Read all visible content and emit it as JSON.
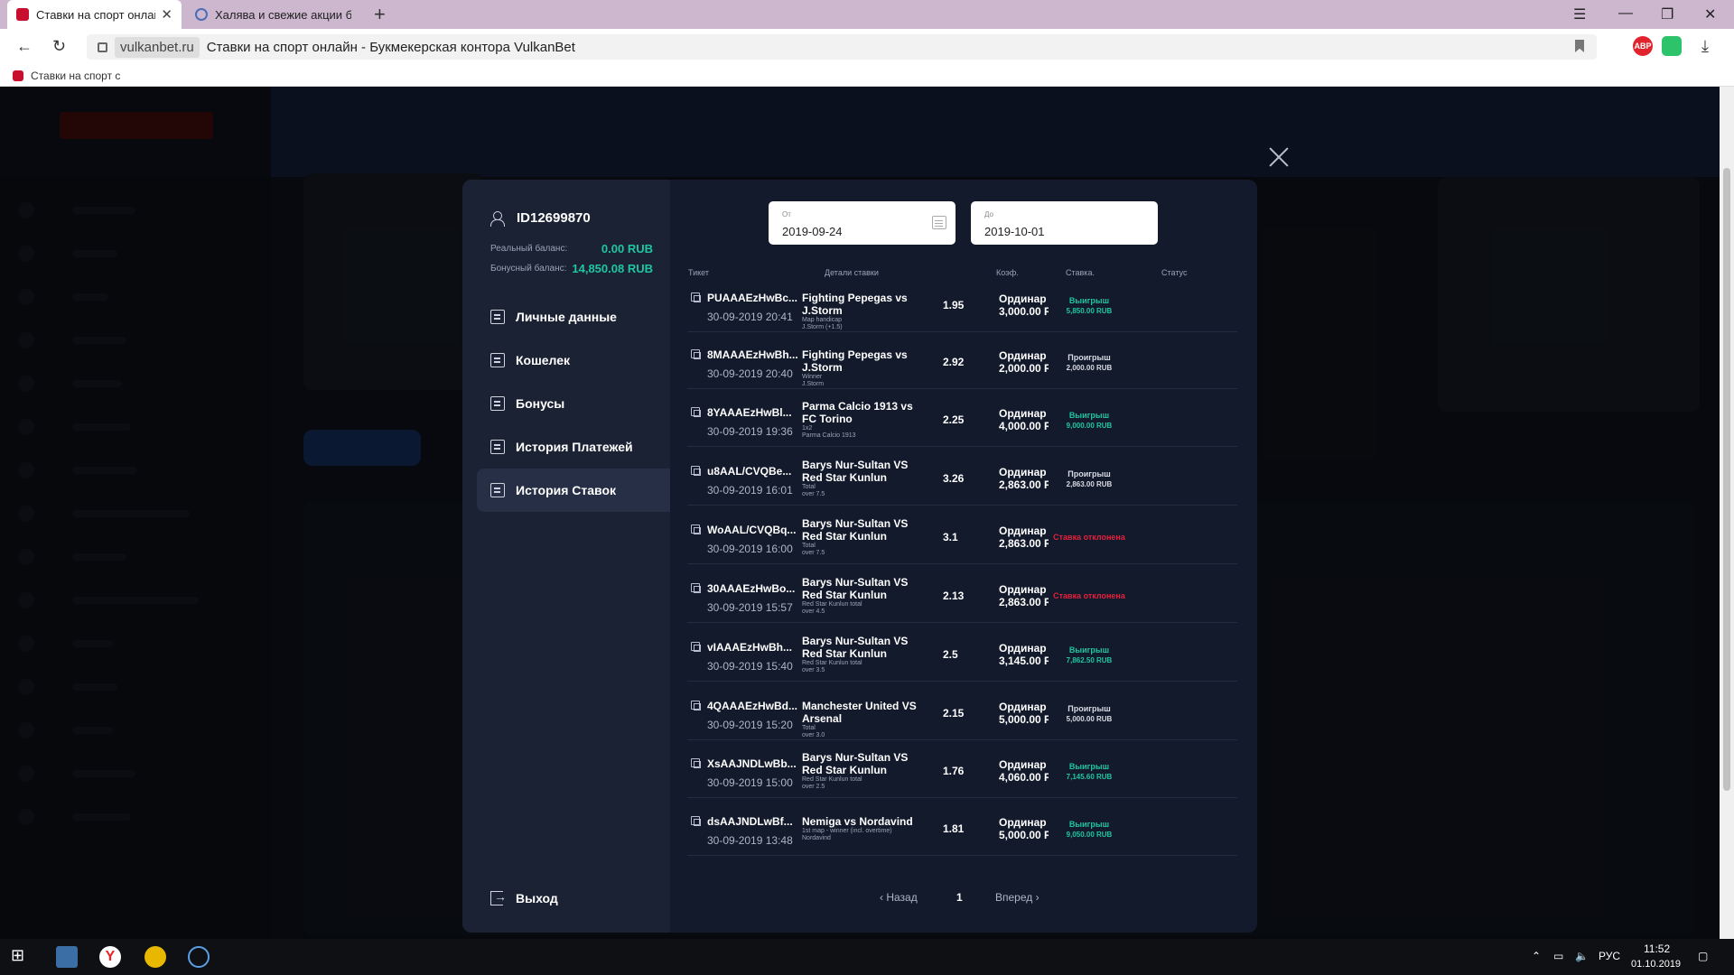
{
  "browser": {
    "tabs": [
      {
        "title": "Ставки на спорт онлайн",
        "active": true
      },
      {
        "title": "Халява и свежие акции бу",
        "active": false
      }
    ],
    "domain": "vulkanbet.ru",
    "page_title": "Ставки на спорт онлайн - Букмекерская контора VulkanBet",
    "bookmark": "Ставки на спорт с",
    "ext_abp": "ABP"
  },
  "modal": {
    "user_id": "ID12699870",
    "real_balance_label": "Реальный баланс:",
    "real_balance": "0.00 RUB",
    "bonus_balance_label": "Бонусный баланс:",
    "bonus_balance": "14,850.08 RUB",
    "menu": [
      {
        "label": "Личные данные",
        "icon": "user-data-icon"
      },
      {
        "label": "Кошелек",
        "icon": "wallet-icon"
      },
      {
        "label": "Бонусы",
        "icon": "gift-icon"
      },
      {
        "label": "История Платежей",
        "icon": "card-icon"
      },
      {
        "label": "История Ставок",
        "icon": "bet-history-icon",
        "active": true
      }
    ],
    "logout": "Выход",
    "date_from_label": "От",
    "date_from": "2019-09-24",
    "date_to_label": "До",
    "date_to": "2019-10-01",
    "columns": [
      "Тикет",
      "Детали ставки",
      "Коэф.",
      "Ставка.",
      "Статус"
    ],
    "rows": [
      {
        "ticket": "PUAAAEzHwBc...",
        "date": "30-09-2019 20:41",
        "event": "Fighting Pepegas vs J.Storm",
        "market": "Map handicap",
        "pick": "J.Storm (+1.5)",
        "coef": "1.95",
        "type": "Ординар",
        "stake": "3,000.00 RUB",
        "status": "Выигрыш",
        "status_amount": "5,850.00 RUB",
        "kind": "win"
      },
      {
        "ticket": "8MAAAEzHwBh...",
        "date": "30-09-2019 20:40",
        "event": "Fighting Pepegas vs J.Storm",
        "market": "Winner",
        "pick": "J.Storm",
        "coef": "2.92",
        "type": "Ординар",
        "stake": "2,000.00 RUB",
        "status": "Проигрыш",
        "status_amount": "2,000.00 RUB",
        "kind": "lose"
      },
      {
        "ticket": "8YAAAEzHwBl...",
        "date": "30-09-2019 19:36",
        "event": "Parma Calcio 1913 vs FC Torino",
        "market": "1x2",
        "pick": "Parma Calcio 1913",
        "coef": "2.25",
        "type": "Ординар",
        "stake": "4,000.00 RUB",
        "status": "Выигрыш",
        "status_amount": "9,000.00 RUB",
        "kind": "win"
      },
      {
        "ticket": "u8AAL/CVQBe...",
        "date": "30-09-2019 16:01",
        "event": "Barys Nur-Sultan VS Red Star Kunlun",
        "market": "Total",
        "pick": "over 7.5",
        "coef": "3.26",
        "type": "Ординар",
        "stake": "2,863.00 RUB",
        "status": "Проигрыш",
        "status_amount": "2,863.00 RUB",
        "kind": "lose"
      },
      {
        "ticket": "WoAAL/CVQBq...",
        "date": "30-09-2019 16:00",
        "event": "Barys Nur-Sultan VS Red Star Kunlun",
        "market": "Total",
        "pick": "over 7.5",
        "coef": "3.1",
        "type": "Ординар",
        "stake": "2,863.00 RUB",
        "status": "Ставка отклонена",
        "status_amount": "",
        "kind": "rej"
      },
      {
        "ticket": "30AAAEzHwBo...",
        "date": "30-09-2019 15:57",
        "event": "Barys Nur-Sultan VS Red Star Kunlun",
        "market": "Red Star Kunlun total",
        "pick": "over 4.5",
        "coef": "2.13",
        "type": "Ординар",
        "stake": "2,863.00 RUB",
        "status": "Ставка отклонена",
        "status_amount": "",
        "kind": "rej"
      },
      {
        "ticket": "vIAAAEzHwBh...",
        "date": "30-09-2019 15:40",
        "event": "Barys Nur-Sultan VS Red Star Kunlun",
        "market": "Red Star Kunlun total",
        "pick": "over 3.5",
        "coef": "2.5",
        "type": "Ординар",
        "stake": "3,145.00 RUB",
        "status": "Выигрыш",
        "status_amount": "7,862.50 RUB",
        "kind": "win"
      },
      {
        "ticket": "4QAAAEzHwBd...",
        "date": "30-09-2019 15:20",
        "event": "Manchester United VS Arsenal",
        "market": "Total",
        "pick": "over 3.0",
        "coef": "2.15",
        "type": "Ординар",
        "stake": "5,000.00 RUB",
        "status": "Проигрыш",
        "status_amount": "5,000.00 RUB",
        "kind": "lose"
      },
      {
        "ticket": "XsAAJNDLwBb...",
        "date": "30-09-2019 15:00",
        "event": "Barys Nur-Sultan VS Red Star Kunlun",
        "market": "Red Star Kunlun total",
        "pick": "over 2.5",
        "coef": "1.76",
        "type": "Ординар",
        "stake": "4,060.00 RUB",
        "status": "Выигрыш",
        "status_amount": "7,145.60 RUB",
        "kind": "win"
      },
      {
        "ticket": "dsAAJNDLwBf...",
        "date": "30-09-2019 13:48",
        "event": "Nemiga vs Nordavind",
        "market": "1st map - winner (incl. overtime)",
        "pick": "Nordavind",
        "coef": "1.81",
        "type": "Ординар",
        "stake": "5,000.00 RUB",
        "status": "Выигрыш",
        "status_amount": "9,050.00 RUB",
        "kind": "win"
      }
    ],
    "pager": {
      "prev": "Назад",
      "page": "1",
      "next": "Вперед"
    }
  },
  "taskbar": {
    "lang": "РУС",
    "time": "11:52",
    "date": "01.10.2019"
  },
  "colors": {
    "win": "#1fc6a0",
    "lose": "#d8dbe3",
    "rejected": "#e5213b",
    "modal_bg": "#131a2c",
    "modal_side": "#1b2234"
  }
}
